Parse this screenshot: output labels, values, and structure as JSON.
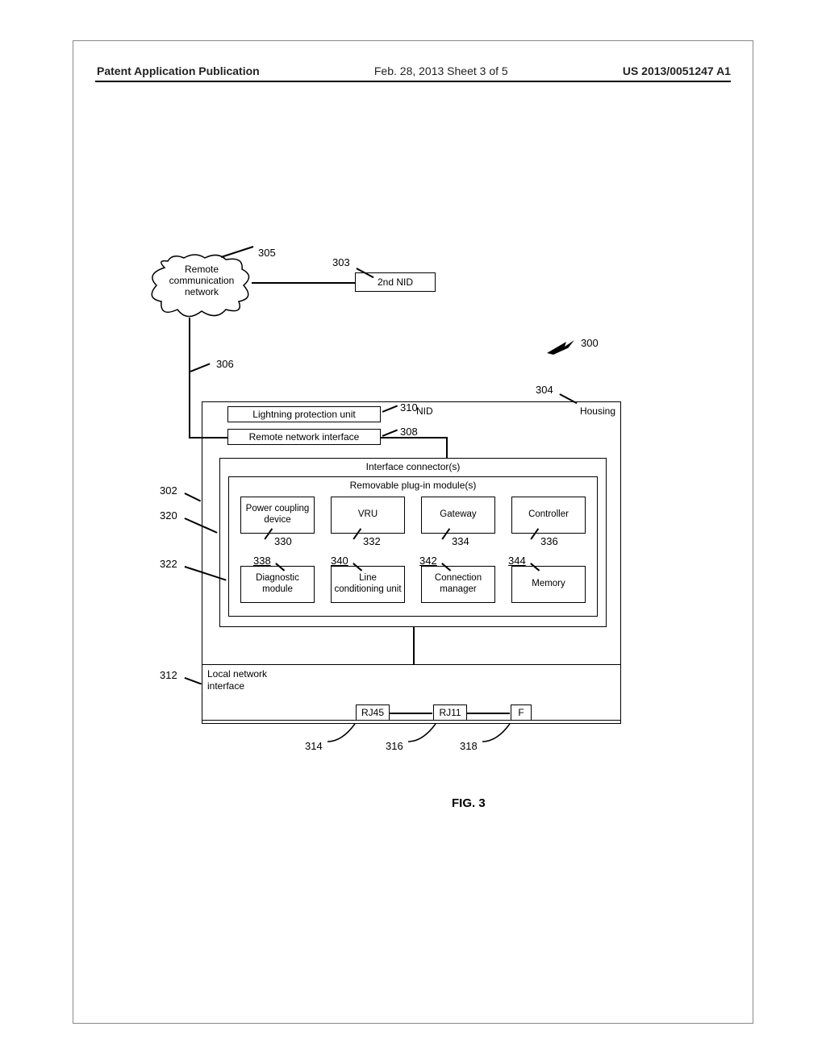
{
  "header": {
    "left": "Patent Application Publication",
    "mid": "Feb. 28, 2013  Sheet 3 of 5",
    "right": "US 2013/0051247 A1"
  },
  "figure_label": "FIG. 3",
  "cloud": {
    "l1": "Remote",
    "l2": "communication",
    "l3": "network"
  },
  "nid2": "2nd NID",
  "housing": "Housing",
  "nid_label": "NID",
  "lpu": "Lightning protection unit",
  "rni": "Remote network interface",
  "iconn": "Interface connector(s)",
  "rpm": "Removable plug-in module(s)",
  "lni": {
    "l1": "Local network",
    "l2": "interface"
  },
  "jacks": {
    "rj45": "RJ45",
    "rj11": "RJ11",
    "f": "F"
  },
  "modules_row1": [
    "Power coupling device",
    "VRU",
    "Gateway",
    "Controller"
  ],
  "modules_row2": [
    "Diagnostic module",
    "Line conditioning unit",
    "Connection manager",
    "Memory"
  ],
  "refs": {
    "r300": "300",
    "r302": "302",
    "r303": "303",
    "r304": "304",
    "r305": "305",
    "r306": "306",
    "r308": "308",
    "r310": "310",
    "r312": "312",
    "r314": "314",
    "r316": "316",
    "r318": "318",
    "r320": "320",
    "r322": "322",
    "r330": "330",
    "r332": "332",
    "r334": "334",
    "r336": "336",
    "r338": "338",
    "r340": "340",
    "r342": "342",
    "r344": "344"
  },
  "chart_data": {
    "type": "diagram",
    "title": "FIG. 3",
    "nodes": [
      {
        "id": 305,
        "label": "Remote communication network",
        "kind": "cloud"
      },
      {
        "id": 303,
        "label": "2nd NID",
        "kind": "box"
      },
      {
        "id": 300,
        "label": "(overall system)",
        "kind": "pointer"
      },
      {
        "id": 306,
        "label": "(link)",
        "kind": "link"
      },
      {
        "id": 302,
        "label": "NID",
        "kind": "container",
        "children": [
          304,
          310,
          308,
          320,
          322,
          312
        ]
      },
      {
        "id": 304,
        "label": "Housing",
        "kind": "container"
      },
      {
        "id": 310,
        "label": "Lightning protection unit",
        "kind": "box"
      },
      {
        "id": 308,
        "label": "Remote network interface",
        "kind": "box"
      },
      {
        "id": 320,
        "label": "Interface connector(s)",
        "kind": "container",
        "children": [
          322
        ]
      },
      {
        "id": 322,
        "label": "Removable plug-in module(s)",
        "kind": "container",
        "children": [
          330,
          332,
          334,
          336,
          338,
          340,
          342,
          344
        ]
      },
      {
        "id": 330,
        "label": "Power coupling device",
        "kind": "box"
      },
      {
        "id": 332,
        "label": "VRU",
        "kind": "box"
      },
      {
        "id": 334,
        "label": "Gateway",
        "kind": "box"
      },
      {
        "id": 336,
        "label": "Controller",
        "kind": "box"
      },
      {
        "id": 338,
        "label": "Diagnostic module",
        "kind": "box"
      },
      {
        "id": 340,
        "label": "Line conditioning unit",
        "kind": "box"
      },
      {
        "id": 342,
        "label": "Connection manager",
        "kind": "box"
      },
      {
        "id": 344,
        "label": "Memory",
        "kind": "box"
      },
      {
        "id": 312,
        "label": "Local network interface",
        "kind": "container",
        "children": [
          314,
          316,
          318
        ]
      },
      {
        "id": 314,
        "label": "RJ45",
        "kind": "jack"
      },
      {
        "id": 316,
        "label": "RJ11",
        "kind": "jack"
      },
      {
        "id": 318,
        "label": "F",
        "kind": "jack"
      }
    ],
    "edges": [
      {
        "from": 305,
        "to": 303
      },
      {
        "from": 305,
        "to": 308,
        "via": 306
      },
      {
        "from": 308,
        "to": 320
      },
      {
        "from": 320,
        "to": 312
      },
      {
        "from": 314,
        "to": 316
      },
      {
        "from": 316,
        "to": 318
      }
    ]
  }
}
